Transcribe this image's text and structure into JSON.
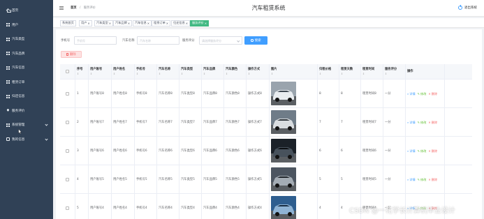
{
  "sidebar": {
    "items": [
      {
        "label": "首页",
        "icon": "home-icon",
        "chevron": false
      },
      {
        "label": "用户",
        "icon": "grid-icon",
        "chevron": false
      },
      {
        "label": "汽车类型",
        "icon": "grid-icon",
        "chevron": false
      },
      {
        "label": "汽车品牌",
        "icon": "grid-icon",
        "chevron": false
      },
      {
        "label": "汽车信息",
        "icon": "grid-icon",
        "chevron": false
      },
      {
        "label": "租赁订单",
        "icon": "grid-icon",
        "chevron": false
      },
      {
        "label": "归还信息",
        "icon": "grid-icon",
        "chevron": false
      },
      {
        "label": "服务评价",
        "icon": "pin-icon",
        "chevron": false
      },
      {
        "label": "系统管理",
        "icon": "grid-icon",
        "chevron": true
      },
      {
        "label": "我的信息",
        "icon": "box-icon",
        "chevron": true
      }
    ]
  },
  "header": {
    "breadcrumb_home": "首页",
    "breadcrumb_sep": "/",
    "breadcrumb_current": "服务评价",
    "title": "汽车租赁系统",
    "logout": "退出系统"
  },
  "tags": [
    {
      "label": "系统首页",
      "closable": false,
      "active": false
    },
    {
      "label": "用户",
      "closable": true,
      "active": false
    },
    {
      "label": "汽车类型",
      "closable": true,
      "active": false
    },
    {
      "label": "汽车品牌",
      "closable": true,
      "active": false
    },
    {
      "label": "汽车信息",
      "closable": true,
      "active": false
    },
    {
      "label": "租赁订单",
      "closable": true,
      "active": false
    },
    {
      "label": "归还信息",
      "closable": true,
      "active": false
    },
    {
      "label": "服务评价",
      "closable": true,
      "active": true
    }
  ],
  "search": {
    "phone_label": "手机号",
    "phone_placeholder": "手机号",
    "car_name_label": "汽车名称",
    "car_name_placeholder": "汽车名称",
    "rating_label": "服务评分",
    "rating_placeholder": "请选择服务评分",
    "search_button": "搜索"
  },
  "delete_button": "删除",
  "table": {
    "headers": [
      "",
      "序号",
      "用户账号",
      "用户姓名",
      "手机号",
      "汽车名称",
      "汽车类型",
      "汽车品牌",
      "汽车颜色",
      "操作方式",
      "图片",
      "归租价格",
      "租赁天数",
      "租赁时间",
      "服务评分",
      "操作"
    ],
    "actions": {
      "detail": "详情",
      "edit": "修改",
      "delete": "删除"
    },
    "rows": [
      {
        "index": "1",
        "account": "用户账号8",
        "name": "用户姓名8",
        "phone": "手机号8",
        "car_name": "汽车名称8",
        "car_type": "汽车类型8",
        "brand": "汽车品牌8",
        "color": "汽车颜色8",
        "mode": "操作方式8",
        "price": "8",
        "days": "8",
        "rent_time": "租赁时间8",
        "rating": "一分"
      },
      {
        "index": "2",
        "account": "用户账号7",
        "name": "用户姓名7",
        "phone": "手机号7",
        "car_name": "汽车名称7",
        "car_type": "汽车类型7",
        "brand": "汽车品牌7",
        "color": "汽车颜色7",
        "mode": "操作方式7",
        "price": "7",
        "days": "7",
        "rent_time": "租赁时间7",
        "rating": "一分"
      },
      {
        "index": "3",
        "account": "用户账号6",
        "name": "用户姓名6",
        "phone": "手机号6",
        "car_name": "汽车名称6",
        "car_type": "汽车类型6",
        "brand": "汽车品牌6",
        "color": "汽车颜色6",
        "mode": "操作方式6",
        "price": "6",
        "days": "6",
        "rent_time": "租赁时间6",
        "rating": "一分"
      },
      {
        "index": "4",
        "account": "用户账号5",
        "name": "用户姓名5",
        "phone": "手机号5",
        "car_name": "汽车名称5",
        "car_type": "汽车类型5",
        "brand": "汽车品牌5",
        "color": "汽车颜色5",
        "mode": "操作方式5",
        "price": "5",
        "days": "5",
        "rent_time": "租赁时间5",
        "rating": "一分"
      },
      {
        "index": "5",
        "account": "用户账号4",
        "name": "用户姓名4",
        "phone": "手机号4",
        "car_name": "汽车名称4",
        "car_type": "汽车类型4",
        "brand": "汽车品牌4",
        "color": "汽车颜色4",
        "mode": "操作方式4",
        "price": "4",
        "days": "4",
        "rent_time": "租赁时间4",
        "rating": "一分"
      }
    ]
  },
  "watermark": "CSDN @一花学长计算机毕业设计",
  "colors": {
    "sidebar_bg": "#304156",
    "primary": "#409eff",
    "active_tag": "#42b983",
    "danger": "#f56c6c",
    "success": "#67c23a"
  }
}
